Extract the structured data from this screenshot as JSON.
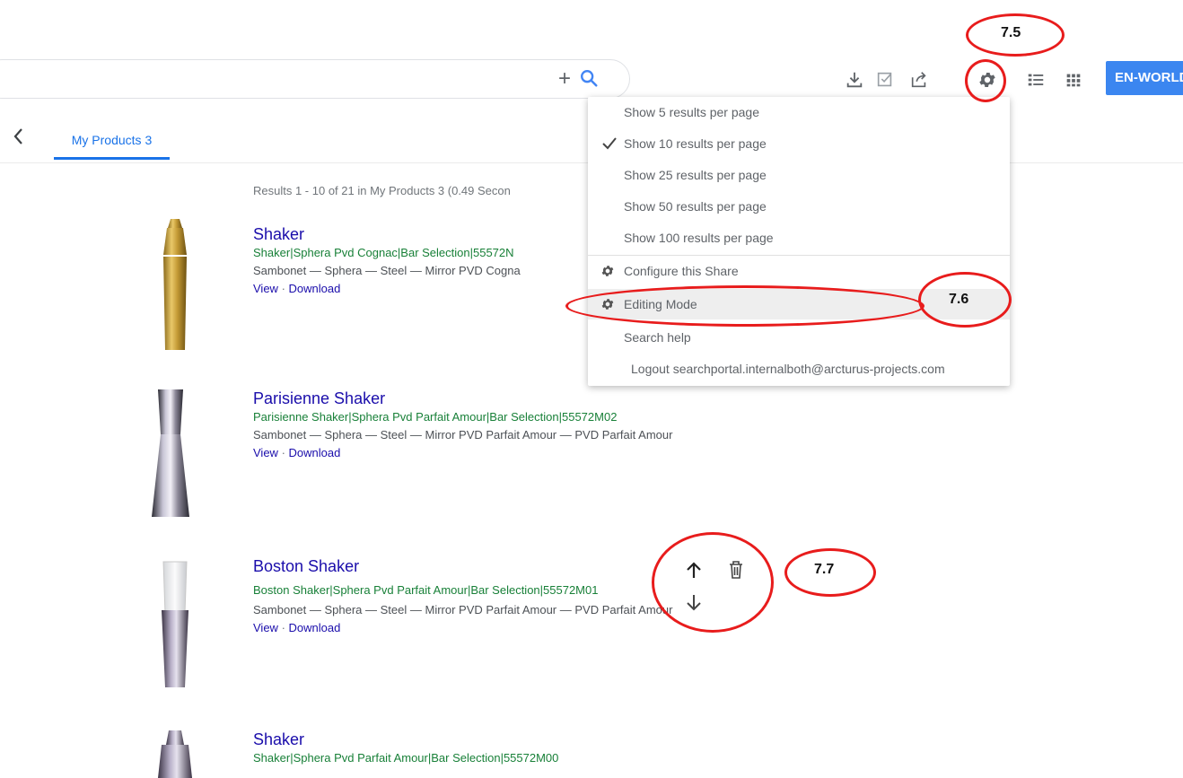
{
  "search": {
    "plus_icon": "plus-icon",
    "search_icon": "search-icon"
  },
  "toolbar": {
    "icons": [
      "download-icon",
      "checklist-icon",
      "share-icon",
      "gear-icon",
      "list-view-icon",
      "grid-view-icon"
    ],
    "language_label": "EN-WORLD"
  },
  "tabs": {
    "back_icon": "chevron-left-icon",
    "active_label": "My Products 3"
  },
  "results_info": "Results 1 - 10 of 21 in My Products 3 (0.49 Secon",
  "results": [
    {
      "title": "Shaker",
      "url": "Shaker|Sphera Pvd Cognac|Bar Selection|55572N",
      "desc": "Sambonet — Sphera — Steel — Mirror PVD Cogna",
      "view": "View",
      "sep": " · ",
      "download": "Download"
    },
    {
      "title": "Parisienne Shaker",
      "url": "Parisienne Shaker|Sphera Pvd Parfait Amour|Bar Selection|55572M02",
      "desc": "Sambonet — Sphera — Steel — Mirror PVD Parfait Amour — PVD Parfait Amour",
      "view": "View",
      "sep": " · ",
      "download": "Download"
    },
    {
      "title": "Boston Shaker",
      "url": "Boston Shaker|Sphera Pvd Parfait Amour|Bar Selection|55572M01",
      "desc": "Sambonet — Sphera — Steel — Mirror PVD Parfait Amour — PVD Parfait Amour",
      "view": "View",
      "sep": " · ",
      "download": "Download"
    },
    {
      "title": "Shaker",
      "url": "Shaker|Sphera Pvd Parfait Amour|Bar Selection|55572M00"
    }
  ],
  "menu": {
    "items": [
      {
        "label": "Show 5 results per page",
        "checked": false
      },
      {
        "label": "Show 10 results per page",
        "checked": true
      },
      {
        "label": "Show 25 results per page",
        "checked": false
      },
      {
        "label": "Show 50 results per page",
        "checked": false
      },
      {
        "label": "Show 100 results per page",
        "checked": false
      },
      {
        "label": "Configure this Share",
        "icon": "gear-icon"
      },
      {
        "label": "Editing Mode",
        "icon": "gear-icon",
        "highlighted": true
      },
      {
        "label": "Search help"
      },
      {
        "label": "Logout searchportal.internalboth@arcturus-projects.com"
      }
    ]
  },
  "edit_controls": {
    "icons": [
      "arrow-up-icon",
      "delete-icon",
      "arrow-down-icon"
    ]
  },
  "annotations": {
    "a1": "7.5",
    "a2": "7.6",
    "a3": "7.7",
    "color": "#e81c1c"
  },
  "colors": {
    "accent": "#1a73e8",
    "link": "#1a0dab",
    "url_green": "#188038",
    "lang_button": "#3b86f0"
  }
}
